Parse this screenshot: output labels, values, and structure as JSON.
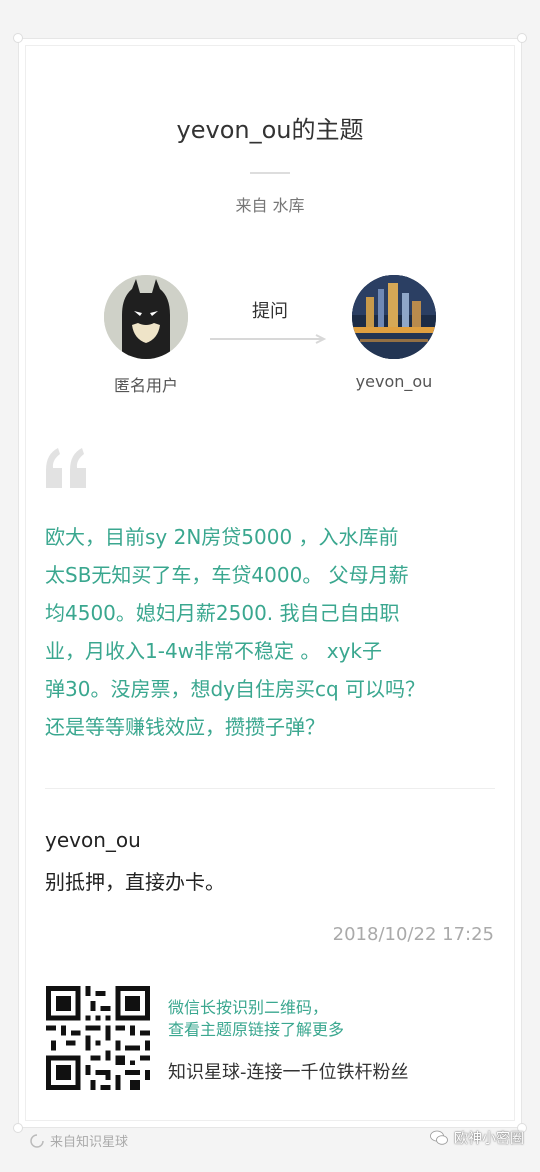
{
  "topic": {
    "title": "yevon_ou的主题",
    "source": "来自 水库"
  },
  "asker": {
    "name": "匿名用户",
    "avatar_icon": "batman-avatar"
  },
  "action": {
    "label": "提问"
  },
  "answerer": {
    "name": "yevon_ou",
    "avatar_icon": "city-night-avatar"
  },
  "question": {
    "lines": [
      "欧大，目前sy  2N房贷5000    ，入水库前",
      "太SB无知买了车，车贷4000。   父母月薪",
      "均4500。媳妇月薪2500.   我自己自由职",
      "业，月收入1-4w非常不稳定  。      xyk子",
      "弹30。没房票，想dy自住房买cq  可以吗？",
      "还是等等赚钱效应，攒攒子弹？"
    ],
    "color": "#3aa78f"
  },
  "answer": {
    "author": "yevon_ou",
    "text": "别抵押，直接办卡。",
    "date": "2018/10/22 17:25"
  },
  "promo": {
    "line1": "微信长按识别二维码，",
    "line2": "查看主题原链接了解更多",
    "slogan": "知识星球-连接一千位铁杆粉丝",
    "qr_icon": "qr-code"
  },
  "footer": {
    "left": "来自知识星球",
    "right": "欧神小密圈"
  }
}
